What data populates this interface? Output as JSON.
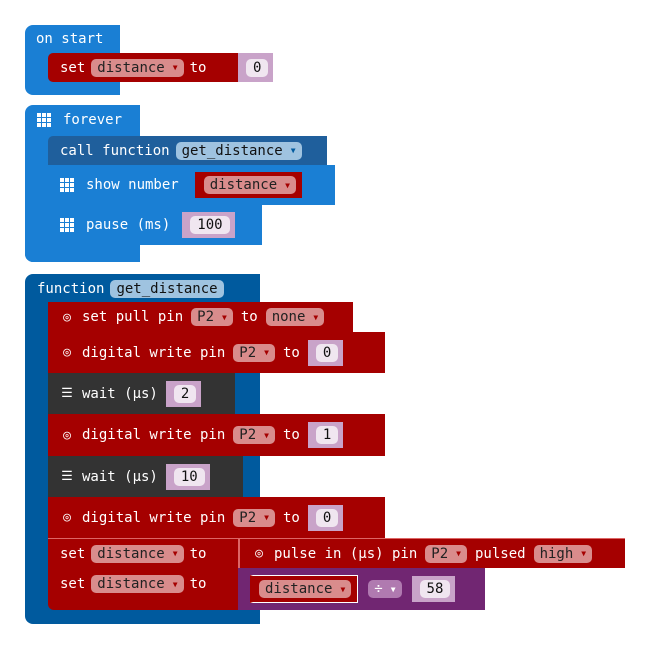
{
  "on_start": {
    "label": "on start",
    "set": "set",
    "var": "distance",
    "to": "to",
    "value": "0"
  },
  "forever": {
    "label": "forever",
    "call": "call function",
    "func": "get_distance",
    "show": "show number",
    "show_var": "distance",
    "pause": "pause (ms)",
    "pause_value": "100"
  },
  "function": {
    "label": "function",
    "name": "get_distance",
    "set_pull": {
      "text": "set pull pin",
      "pin": "P2",
      "to": "to",
      "mode": "none"
    },
    "dw1": {
      "text": "digital write pin",
      "pin": "P2",
      "to": "to",
      "value": "0"
    },
    "wait1": {
      "text": "wait (µs)",
      "value": "2"
    },
    "dw2": {
      "text": "digital write pin",
      "pin": "P2",
      "to": "to",
      "value": "1"
    },
    "wait2": {
      "text": "wait (µs)",
      "value": "10"
    },
    "dw3": {
      "text": "digital write pin",
      "pin": "P2",
      "to": "to",
      "value": "0"
    },
    "set1": {
      "set": "set",
      "var": "distance",
      "to": "to",
      "pulse": "pulse in (µs) pin",
      "pin": "P2",
      "pulsed": "pulsed",
      "level": "high"
    },
    "set2": {
      "set": "set",
      "var": "distance",
      "to": "to",
      "lhs": "distance",
      "op": "÷",
      "rhs": "58"
    }
  },
  "colors": {
    "basic": "#1a7fd4",
    "functions": "#005a9e",
    "pins": "#a50000",
    "control": "#333333",
    "math": "#712672"
  },
  "icons": {
    "grid": "led-grid-icon",
    "pin": "target-icon",
    "control": "server-icon"
  }
}
